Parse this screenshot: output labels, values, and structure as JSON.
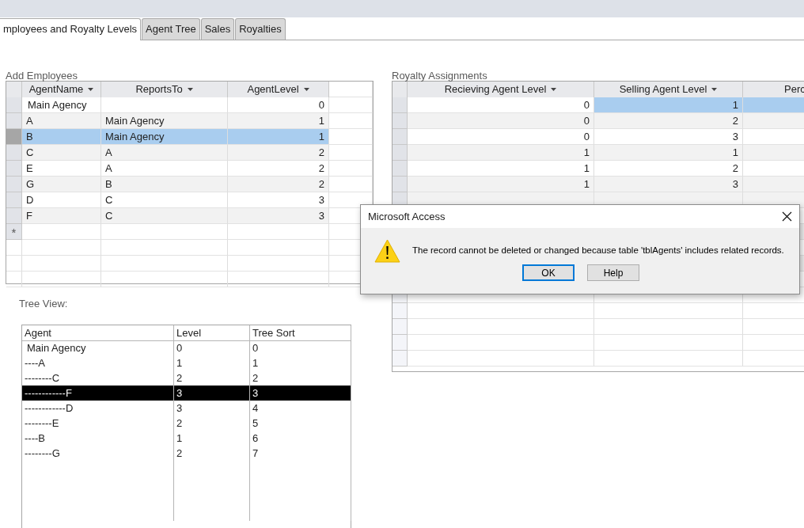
{
  "tabs": [
    {
      "label": "mployees and Royalty Levels",
      "selected": true
    },
    {
      "label": "Agent Tree",
      "selected": false
    },
    {
      "label": "Sales",
      "selected": false
    },
    {
      "label": "Royalties",
      "selected": false
    }
  ],
  "add_employees": {
    "title": "Add Employees",
    "columns": [
      "AgentName",
      "ReportsTo",
      "AgentLevel"
    ],
    "rows": [
      {
        "agent_name": "Main Agency",
        "agent_level": "0",
        "selected": false
      },
      {
        "agent_name": "A",
        "reports_to": "Main Agency",
        "agent_level": "1",
        "selected": false
      },
      {
        "agent_name": "B",
        "reports_to": "Main Agency",
        "agent_level": "1",
        "selected": true
      },
      {
        "agent_name": "C",
        "reports_to": "A",
        "agent_level": "2",
        "selected": false
      },
      {
        "agent_name": "E",
        "reports_to": "A",
        "agent_level": "2",
        "selected": false
      },
      {
        "agent_name": "G",
        "reports_to": "B",
        "agent_level": "2",
        "selected": false
      },
      {
        "agent_name": "D",
        "reports_to": "C",
        "agent_level": "3",
        "selected": false
      },
      {
        "agent_name": "F",
        "reports_to": "C",
        "agent_level": "3",
        "selected": false
      }
    ],
    "new_row_marker": "*"
  },
  "tree_view": {
    "label": "Tree View:",
    "columns": [
      "Agent",
      "Level",
      "Tree Sort"
    ],
    "rows": [
      {
        "agent": "Main Agency",
        "level": "0",
        "tree_sort": "0",
        "selected": false
      },
      {
        "agent": "----A",
        "level": "1",
        "tree_sort": "1",
        "selected": false
      },
      {
        "agent": "--------C",
        "level": "2",
        "tree_sort": "2",
        "selected": false
      },
      {
        "agent": "------------F",
        "level": "3",
        "tree_sort": "3",
        "selected": true
      },
      {
        "agent": "------------D",
        "level": "3",
        "tree_sort": "4",
        "selected": false
      },
      {
        "agent": "--------E",
        "level": "2",
        "tree_sort": "5",
        "selected": false
      },
      {
        "agent": "----B",
        "level": "1",
        "tree_sort": "6",
        "selected": false
      },
      {
        "agent": "--------G",
        "level": "2",
        "tree_sort": "7",
        "selected": false
      }
    ]
  },
  "royalty_assignments": {
    "title": "Royalty Assignments",
    "columns": [
      "Recieving Agent Level",
      "Selling Agent Level",
      "Perc"
    ],
    "rows": [
      {
        "receiving": "0",
        "selling": "1",
        "selected": true
      },
      {
        "receiving": "0",
        "selling": "2",
        "selected": false
      },
      {
        "receiving": "0",
        "selling": "3",
        "selected": false
      },
      {
        "receiving": "1",
        "selling": "1",
        "selected": false
      },
      {
        "receiving": "1",
        "selling": "2",
        "selected": false
      },
      {
        "receiving": "1",
        "selling": "3",
        "selected": false
      }
    ]
  },
  "dialog": {
    "title": "Microsoft Access",
    "message": "The record cannot be deleted or changed because table 'tblAgents' includes related records.",
    "buttons": [
      {
        "label": "OK",
        "default": true
      },
      {
        "label": "Help",
        "default": false
      }
    ]
  }
}
